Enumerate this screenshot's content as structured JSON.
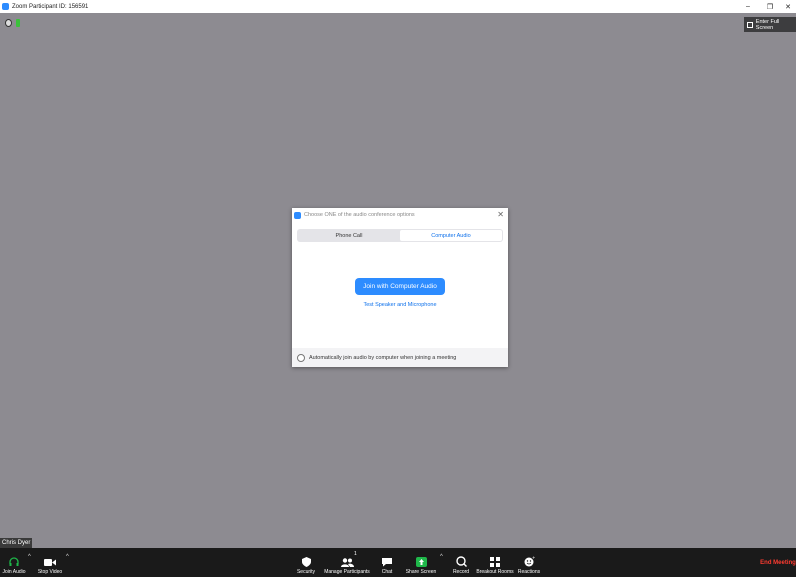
{
  "window": {
    "title": "Zoom Participant ID: 156591",
    "minimize_glyph": "–",
    "restore_glyph": "❐",
    "close_glyph": "✕"
  },
  "top": {
    "fullscreen_label": "Enter Full Screen"
  },
  "dialog": {
    "title": "Choose ONE of the audio conference options",
    "close_glyph": "✕",
    "tabs": [
      {
        "label": "Phone Call",
        "active": false
      },
      {
        "label": "Computer Audio",
        "active": true
      }
    ],
    "join_label": "Join with Computer Audio",
    "test_label": "Test Speaker and Microphone",
    "auto_join_label": "Automatically join audio by computer when joining a meeting"
  },
  "participant": {
    "name": "Chris Dyer"
  },
  "toolbar": {
    "join_audio": "Join Audio",
    "stop_video": "Stop Video",
    "security": "Security",
    "manage_participants": "Manage Participants",
    "participants_count": "1",
    "chat": "Chat",
    "share_screen": "Share Screen",
    "record": "Record",
    "breakout_rooms": "Breakout Rooms",
    "reactions": "Reactions",
    "end_meeting": "End Meeting",
    "caret": "^"
  },
  "colors": {
    "accent": "#2d8cff",
    "end": "#ff3b30",
    "share": "#1fb84a",
    "background": "#8d8b91"
  }
}
